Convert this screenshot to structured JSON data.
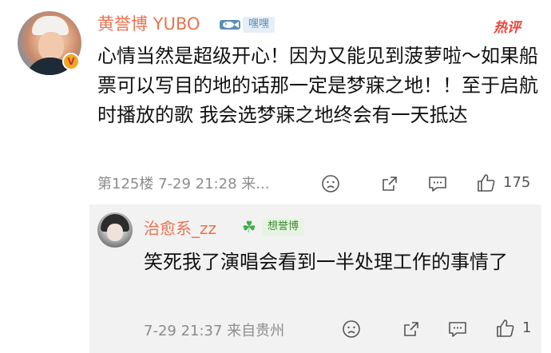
{
  "comment": {
    "username": "黄誉博 YUBO",
    "fan_label": "嘿嘿",
    "hot_label": "热评",
    "body": "心情当然是超级开心！因为又能见到菠萝啦～如果船票可以写目的地的话那一定是梦寐之地！！至于启航时播放的歌 我会选梦寐之地终会有一天抵达",
    "floor_time": "第125楼 7-29 21:28 来...",
    "like_count": "175",
    "icons": [
      "verified-badge-icon",
      "fan-fish-icon",
      "dislike-face-icon",
      "share-icon",
      "comment-icon",
      "like-icon"
    ]
  },
  "reply": {
    "username": "治愈系_zz",
    "clover": "☘",
    "fan_label": "想誉博",
    "body": "笑死我了演唱会看到一半处理工作的事情了",
    "time_location": "7-29 21:37 来自贵州",
    "like_count": "1",
    "icons": [
      "clover-icon",
      "dislike-face-icon",
      "share-icon",
      "comment-icon",
      "like-icon"
    ]
  },
  "colors": {
    "name": "#eb7350",
    "hot": "#f0423a",
    "meta": "#8c8c8c",
    "reply_bg": "#f2f2f2"
  }
}
